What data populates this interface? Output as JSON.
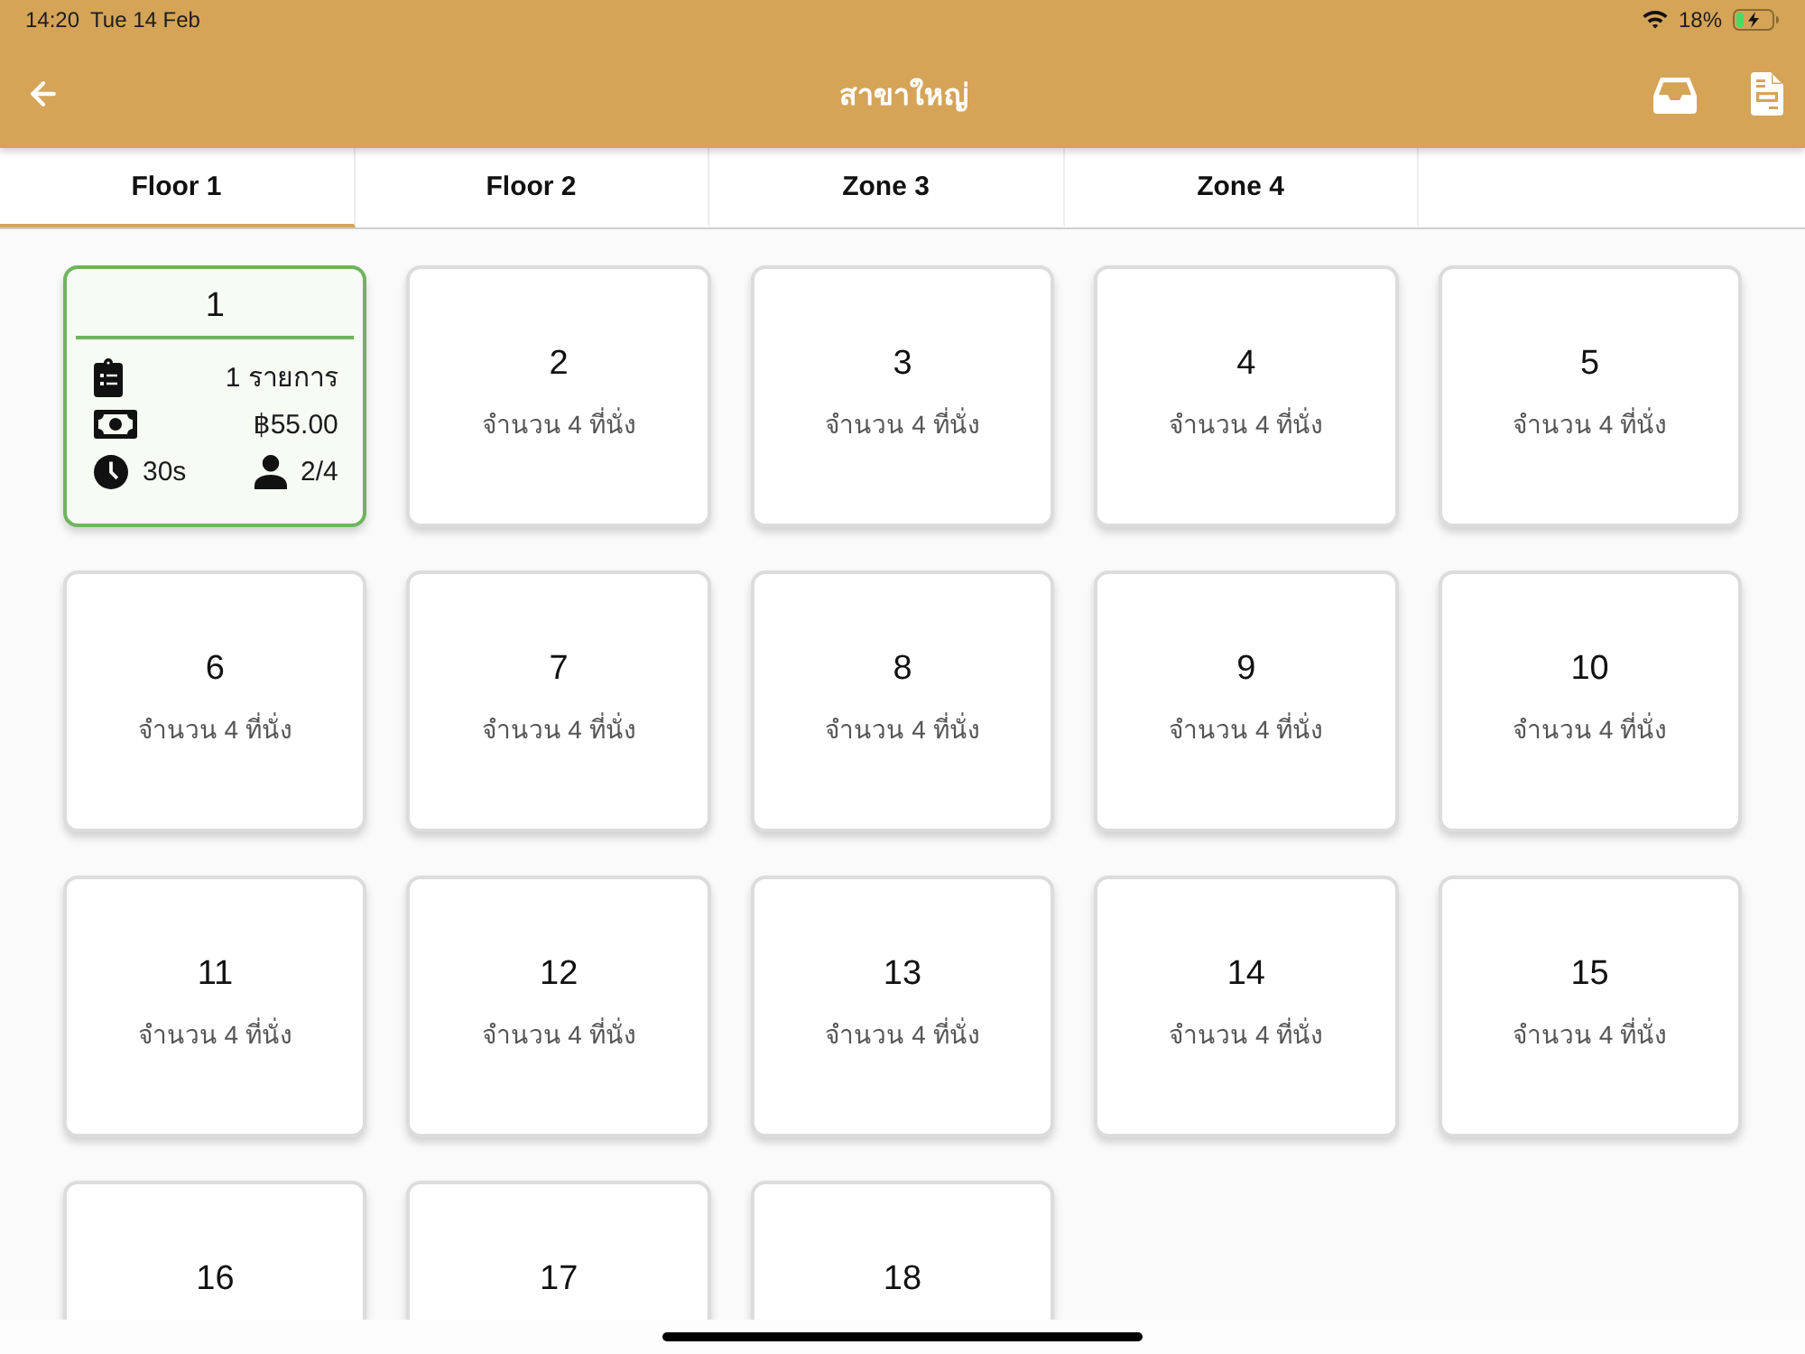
{
  "status_bar": {
    "time": "14:20",
    "date": "Tue 14 Feb",
    "battery": "18%"
  },
  "header": {
    "title": "สาขาใหญ่"
  },
  "tabs": [
    {
      "label": "Floor 1",
      "selected": true
    },
    {
      "label": "Floor 2",
      "selected": false
    },
    {
      "label": "Zone 3",
      "selected": false
    },
    {
      "label": "Zone 4",
      "selected": false
    }
  ],
  "tables": [
    {
      "kind": "occupied",
      "number": "1",
      "orders": "1 รายการ",
      "amount": "฿55.00",
      "elapsed": "30s",
      "guests": "2/4"
    },
    {
      "kind": "free",
      "number": "2",
      "seats": "จำนวน 4 ที่นั่ง"
    },
    {
      "kind": "free",
      "number": "3",
      "seats": "จำนวน 4 ที่นั่ง"
    },
    {
      "kind": "free",
      "number": "4",
      "seats": "จำนวน 4 ที่นั่ง"
    },
    {
      "kind": "free",
      "number": "5",
      "seats": "จำนวน 4 ที่นั่ง"
    },
    {
      "kind": "free",
      "number": "6",
      "seats": "จำนวน 4 ที่นั่ง"
    },
    {
      "kind": "free",
      "number": "7",
      "seats": "จำนวน 4 ที่นั่ง"
    },
    {
      "kind": "free",
      "number": "8",
      "seats": "จำนวน 4 ที่นั่ง"
    },
    {
      "kind": "free",
      "number": "9",
      "seats": "จำนวน 4 ที่นั่ง"
    },
    {
      "kind": "free",
      "number": "10",
      "seats": "จำนวน 4 ที่นั่ง"
    },
    {
      "kind": "free",
      "number": "11",
      "seats": "จำนวน 4 ที่นั่ง"
    },
    {
      "kind": "free",
      "number": "12",
      "seats": "จำนวน 4 ที่นั่ง"
    },
    {
      "kind": "free",
      "number": "13",
      "seats": "จำนวน 4 ที่นั่ง"
    },
    {
      "kind": "free",
      "number": "14",
      "seats": "จำนวน 4 ที่นั่ง"
    },
    {
      "kind": "free",
      "number": "15",
      "seats": "จำนวน 4 ที่นั่ง"
    },
    {
      "kind": "free",
      "number": "16"
    },
    {
      "kind": "free",
      "number": "17"
    },
    {
      "kind": "free",
      "number": "18"
    }
  ]
}
